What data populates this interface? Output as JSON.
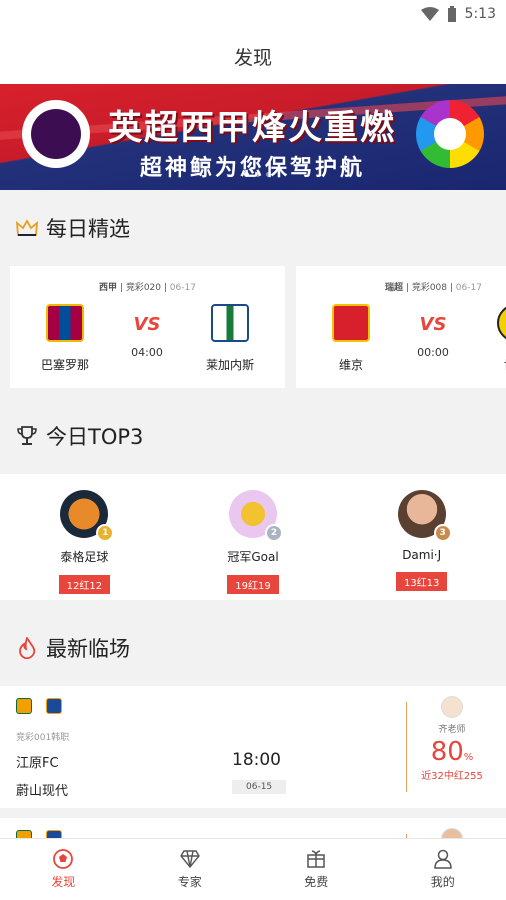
{
  "status": {
    "time": "5:13"
  },
  "header": {
    "title": "发现"
  },
  "banner": {
    "title": "英超西甲烽火重燃",
    "subtitle": "超神鲸为您保驾护航"
  },
  "daily": {
    "title": "每日精选",
    "matches": [
      {
        "league": "西甲",
        "code": "竞彩020",
        "date": "06-17",
        "home": "巴塞罗那",
        "away": "莱加内斯",
        "vs": "VS",
        "time": "04:00"
      },
      {
        "league": "瑞超",
        "code": "竞彩008",
        "date": "06-17",
        "home": "维京",
        "away": "博德",
        "vs": "VS",
        "time": "00:00"
      }
    ]
  },
  "top3": {
    "title": "今日TOP3",
    "experts": [
      {
        "name": "泰格足球",
        "rank": "1",
        "record": "12红12"
      },
      {
        "name": "冠军Goal",
        "rank": "2",
        "record": "19红19"
      },
      {
        "name": "Dami·J",
        "rank": "3",
        "record": "13红13"
      }
    ]
  },
  "latest": {
    "title": "最新临场",
    "matches": [
      {
        "code": "竞彩001韩职",
        "home": "江原FC",
        "away": "蔚山现代",
        "time": "18:00",
        "date": "06-15",
        "expert": "齐老师",
        "rate": "80",
        "rate_unit": "%",
        "streak": "近32中红255"
      }
    ]
  },
  "tabs": [
    {
      "label": "发现",
      "active": true
    },
    {
      "label": "专家",
      "active": false
    },
    {
      "label": "免费",
      "active": false
    },
    {
      "label": "我的",
      "active": false
    }
  ],
  "colors": {
    "accent": "#e8453c",
    "banner_red": "#d8202c",
    "banner_blue": "#1a2670"
  }
}
